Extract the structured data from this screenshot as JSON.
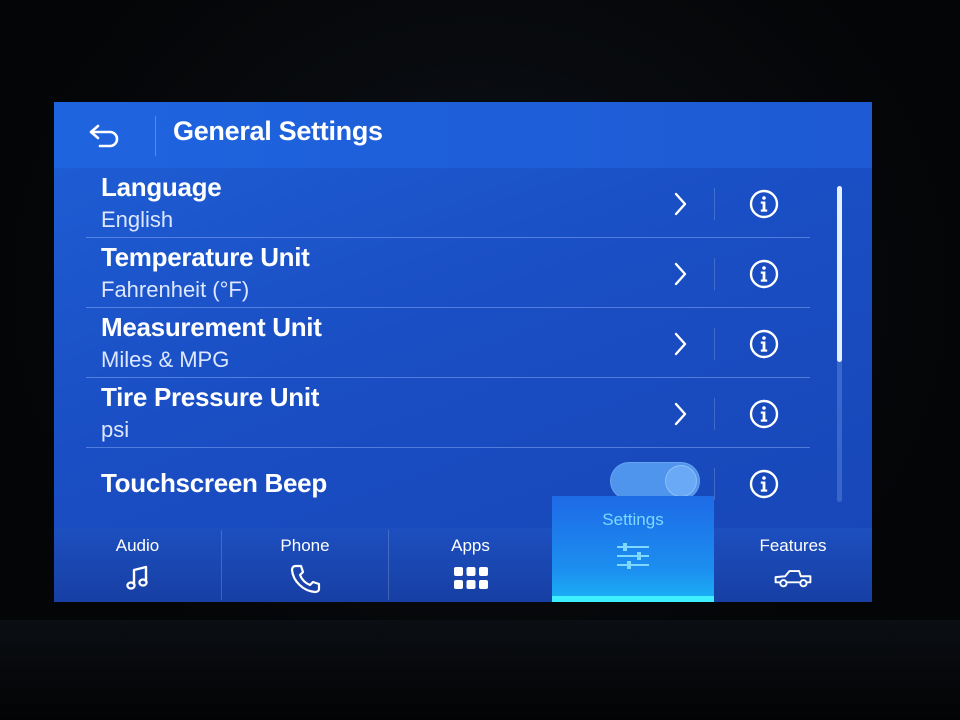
{
  "header": {
    "title": "General Settings",
    "back_icon": "back-arrow-icon"
  },
  "settings": [
    {
      "title": "Language",
      "value": "English",
      "control": "chevron"
    },
    {
      "title": "Temperature Unit",
      "value": "Fahrenheit (°F)",
      "control": "chevron"
    },
    {
      "title": "Measurement Unit",
      "value": "Miles & MPG",
      "control": "chevron"
    },
    {
      "title": "Tire Pressure Unit",
      "value": "psi",
      "control": "chevron"
    },
    {
      "title": "Touchscreen Beep",
      "value": "",
      "control": "toggle",
      "toggle_on": true
    }
  ],
  "nav": {
    "items": [
      {
        "label": "Audio",
        "icon": "music-note-icon"
      },
      {
        "label": "Phone",
        "icon": "phone-icon"
      },
      {
        "label": "Apps",
        "icon": "apps-grid-icon"
      },
      {
        "label": "Settings",
        "icon": "settings-sliders-icon",
        "active": true
      },
      {
        "label": "Features",
        "icon": "truck-icon"
      }
    ]
  },
  "colors": {
    "screen_bg": "#1a4ec4",
    "active_tab": "#1c8ff0",
    "active_indicator": "#3ef0ff",
    "toggle_on": "#4f95ee"
  }
}
